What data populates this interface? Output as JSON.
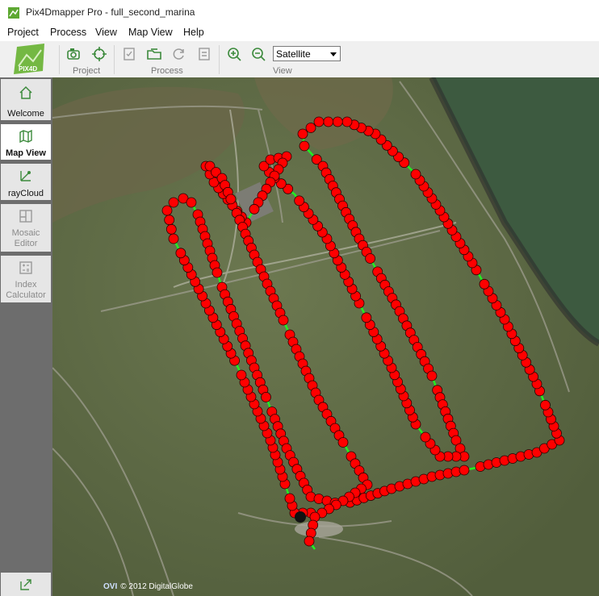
{
  "window": {
    "title": "Pix4Dmapper Pro - full_second_marina"
  },
  "menu": [
    "Project",
    "Process",
    "View",
    "Map View",
    "Help"
  ],
  "toolbar": {
    "groups": [
      "Project",
      "Process",
      "View"
    ],
    "map_type": "Satellite",
    "logo_text": "PIX4D"
  },
  "sidebar": {
    "items": [
      {
        "label": "Welcome",
        "active": false,
        "enabled": true
      },
      {
        "label": "Map View",
        "active": true,
        "enabled": true
      },
      {
        "label": "rayCloud",
        "active": false,
        "enabled": true
      },
      {
        "label": "Mosaic\nEditor",
        "active": false,
        "enabled": false
      },
      {
        "label": "Index\nCalculator",
        "active": false,
        "enabled": false
      }
    ]
  },
  "map": {
    "copyright": "© 2012 DigitalGlobe",
    "provider_logo": "OVI",
    "colors": {
      "image_point": "#ff0000",
      "track": "#22ee22",
      "water": "#3e5b40",
      "grass": "#5f6b44"
    }
  }
}
